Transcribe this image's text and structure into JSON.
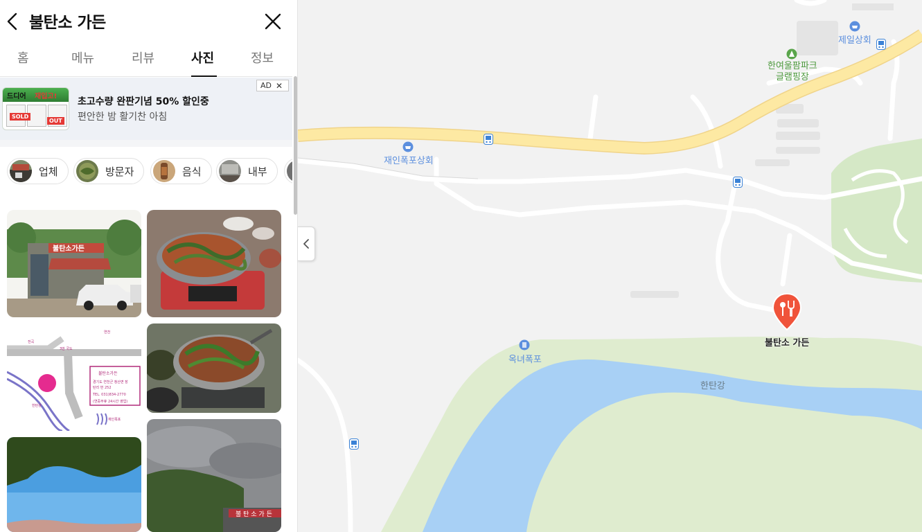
{
  "header": {
    "title": "불탄소 가든"
  },
  "tabs": [
    {
      "label": "홈",
      "active": false
    },
    {
      "label": "메뉴",
      "active": false
    },
    {
      "label": "리뷰",
      "active": false
    },
    {
      "label": "사진",
      "active": true
    },
    {
      "label": "정보",
      "active": false
    }
  ],
  "ad": {
    "line1": "초고수량 완판기념 50% 할인중",
    "line2": "편안한 밤 활기찬 아침",
    "badge": "AD",
    "thumb_text1": "드디어",
    "thumb_text2": "재입고!",
    "thumb_sold": "SOLD",
    "thumb_out": "OUT"
  },
  "chips": [
    {
      "label": "업체",
      "icon": "storefront-thumb"
    },
    {
      "label": "방문자",
      "icon": "visitor-thumb"
    },
    {
      "label": "음식",
      "icon": "food-thumb"
    },
    {
      "label": "내부",
      "icon": "interior-thumb"
    }
  ],
  "photos": [
    {
      "caption": "restaurant-exterior",
      "sign": "불탄소가든"
    },
    {
      "caption": "hotpot-on-burner"
    },
    {
      "caption": "hand-drawn-map",
      "box_title": "불탄소가든",
      "box_lines": [
        "경기도 연천군 청산면 장",
        "탄리 번 252",
        "TEL. 031)834-2770",
        "(연중무휴 24시간 영업)"
      ],
      "labels": [
        "전곡",
        "한탄강",
        "3번 국도",
        "연천",
        "재인폭포"
      ]
    },
    {
      "caption": "spicy-stew-pot"
    },
    {
      "caption": "tree-and-sky"
    },
    {
      "caption": "cloudy-sky-building",
      "sign": "불 탄 소 가 든"
    }
  ],
  "map": {
    "labels": {
      "jeil": "제일상회",
      "glamping": [
        "한여울팜파크",
        "글램핑장"
      ],
      "jaein": "재인폭포상회",
      "okneo": "옥녀폭포",
      "hantan": "한탄강",
      "pin": "불탄소 가든"
    },
    "colors": {
      "background": "#f2f2f2",
      "river": "#a8d0f5",
      "riverbank": "#dfeccf",
      "main_road": "#fde9a3",
      "road": "#ffffff",
      "park": "#d5e8c6",
      "pin": "#f0533a",
      "poi_blue": "#5c8fde",
      "poi_green": "#5aa54b"
    }
  }
}
